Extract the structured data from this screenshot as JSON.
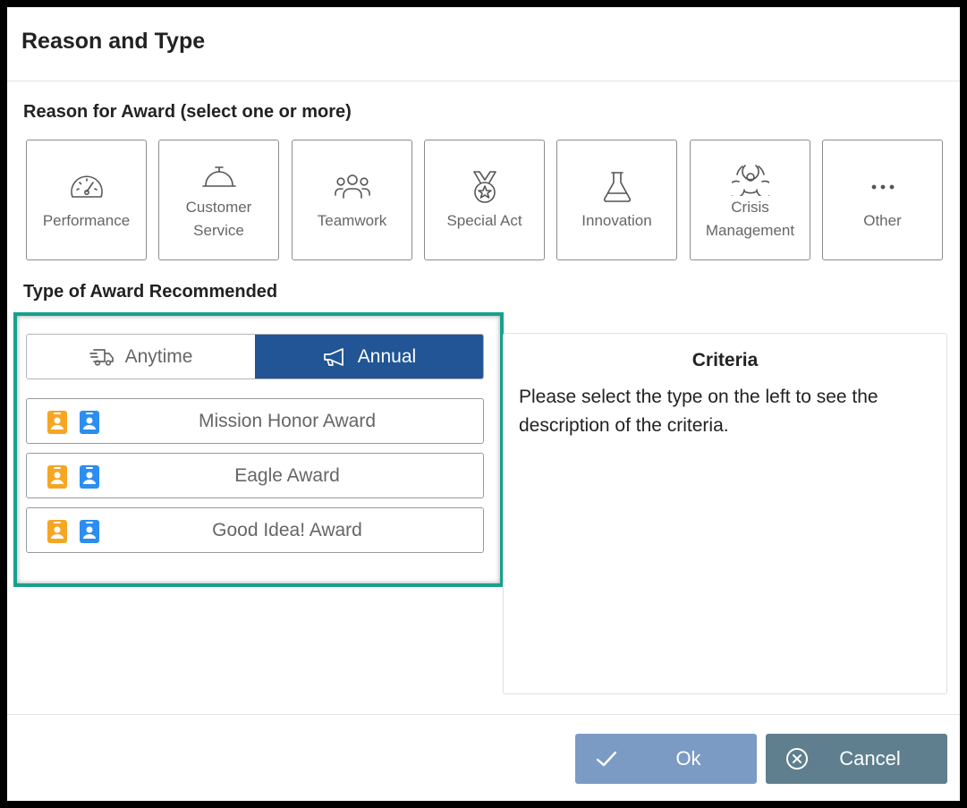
{
  "dialog": {
    "title": "Reason and Type"
  },
  "reason_section": {
    "label": "Reason for Award (select one or more)",
    "items": [
      {
        "label": "Performance",
        "icon": "gauge-icon"
      },
      {
        "label": "Customer Service",
        "icon": "service-bell-icon"
      },
      {
        "label": "Teamwork",
        "icon": "people-group-icon"
      },
      {
        "label": "Special Act",
        "icon": "medal-icon"
      },
      {
        "label": "Innovation",
        "icon": "flask-icon"
      },
      {
        "label": "Crisis Management",
        "icon": "biohazard-icon"
      },
      {
        "label": "Other",
        "icon": "ellipsis-icon"
      }
    ]
  },
  "type_section": {
    "label": "Type of Award Recommended",
    "toggle": {
      "anytime_label": "Anytime",
      "annual_label": "Annual",
      "selected": "Annual"
    },
    "awards": [
      {
        "name": "Mission Honor Award"
      },
      {
        "name": "Eagle Award"
      },
      {
        "name": "Good Idea! Award"
      }
    ]
  },
  "criteria": {
    "title": "Criteria",
    "description": "Please select the type on the left to see the description of the criteria."
  },
  "footer": {
    "ok_label": "Ok",
    "cancel_label": "Cancel"
  },
  "colors": {
    "accent_border": "#17a08e",
    "toggle_selected": "#215596",
    "ok_button": "#7b9bc4",
    "cancel_button": "#5f7f8e",
    "badge_orange": "#f5a623",
    "badge_blue": "#2b8ef0"
  }
}
